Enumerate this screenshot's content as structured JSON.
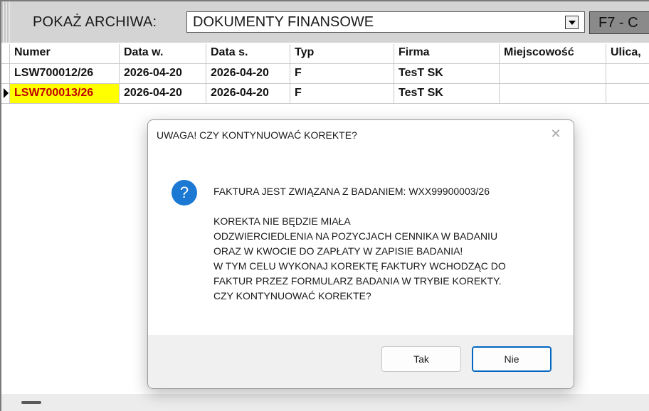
{
  "toolbar": {
    "archive_label": "POKAŻ ARCHIWA:",
    "archive_value": "DOKUMENTY FINANSOWE",
    "f7_label": "F7 - C"
  },
  "grid": {
    "columns": [
      "Numer",
      "Data w.",
      "Data s.",
      "Typ",
      "Firma",
      "Miejscowość",
      "Ulica,"
    ],
    "rows": [
      {
        "numer": "LSW700012/26",
        "data_w": "2026-04-20",
        "data_s": "2026-04-20",
        "typ": "F",
        "firma": "TesT SK",
        "miejscowosc": "",
        "ulica": ""
      },
      {
        "numer": "LSW700013/26",
        "data_w": "2026-04-20",
        "data_s": "2026-04-20",
        "typ": "F",
        "firma": "TesT SK",
        "miejscowosc": "",
        "ulica": ""
      }
    ],
    "selected_row_index": 1
  },
  "dialog": {
    "title": "UWAGA! CZY KONTYNUOWAĆ KOREKTE?",
    "icon": "question-icon",
    "icon_glyph": "?",
    "close_glyph": "✕",
    "message_lines": [
      "FAKTURA JEST ZWIĄZANA Z BADANIEM: WXX99900003/26",
      "",
      "KOREKTA NIE BĘDZIE MIAŁA",
      "ODZWIERCIEDLENIA NA POZYCJACH CENNIKA W BADANIU",
      "ORAZ W KWOCIE DO ZAPŁATY W ZAPISIE BADANIA!",
      "W TYM CELU WYKONAJ KOREKTĘ FAKTURY WCHODZĄC DO",
      "FAKTUR PRZEZ FORMULARZ BADANIA W TRYBIE KOREKTY.",
      "CZY KONTYNUOWAĆ KOREKTE?"
    ],
    "buttons": {
      "yes": "Tak",
      "no": "Nie"
    }
  },
  "colors": {
    "highlight_bg": "#ffff00",
    "highlight_text": "#c00000",
    "dialog_icon": "#1b78d3",
    "default_button_border": "#0067c0"
  }
}
